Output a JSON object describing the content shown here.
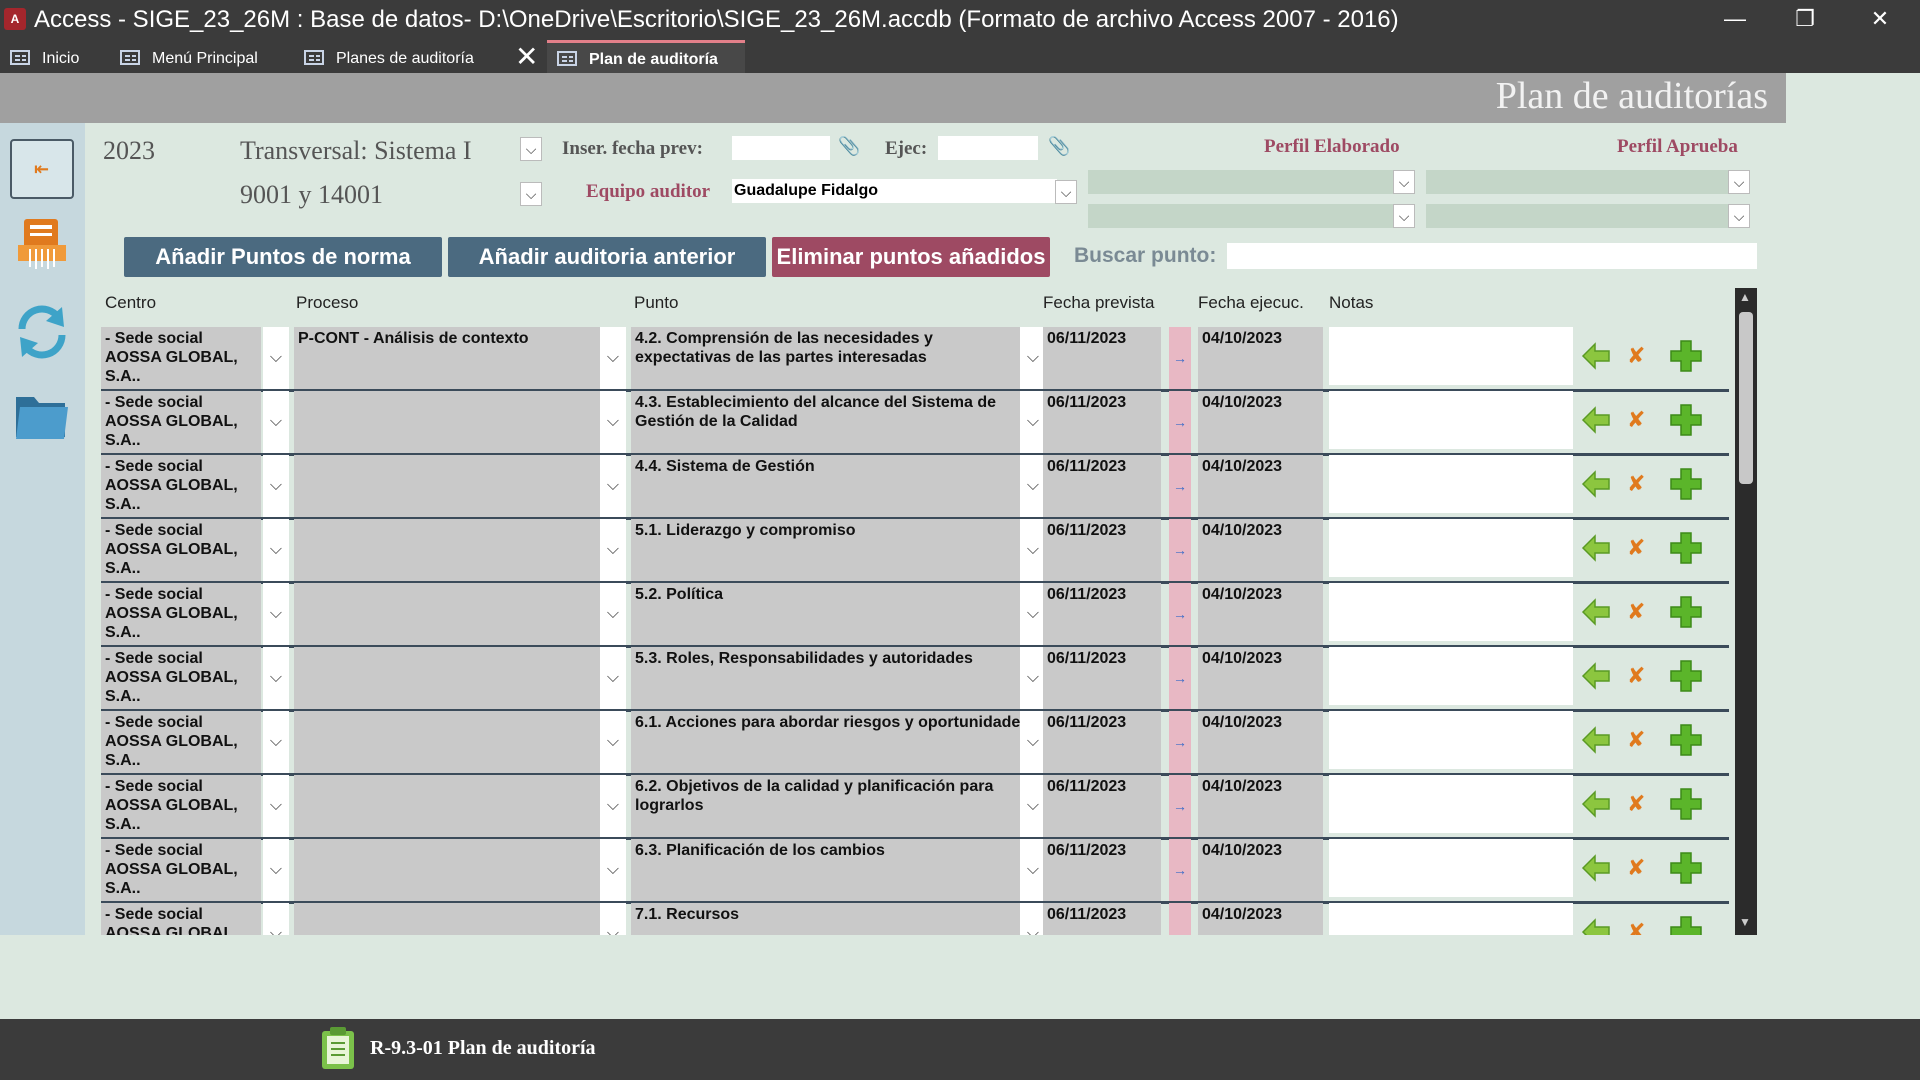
{
  "window": {
    "title": "Access - SIGE_23_26M : Base de datos- D:\\OneDrive\\Escritorio\\SIGE_23_26M.accdb (Formato de archivo Access 2007 - 2016)",
    "app_icon": "A",
    "minimize": "—",
    "restore": "❐",
    "close": "✕"
  },
  "tabs": [
    {
      "label": "Inicio"
    },
    {
      "label": "Menú Principal"
    },
    {
      "label": "Planes de auditoría"
    },
    {
      "label": "Plan de auditoría"
    }
  ],
  "tab_close_glyph": "✕",
  "form": {
    "title": "Plan de auditorías",
    "year": "2023",
    "transversal": "Transversal: Sistema I",
    "norma": "9001 y 14001",
    "inser_fecha_label": "Inser. fecha prev:",
    "ejec_label": "Ejec:",
    "equipo_label": "Equipo auditor",
    "equipo_value": "Guadalupe Fidalgo",
    "perfil_elaborado": "Perfil Elaborado",
    "perfil_aprueba": "Perfil Aprueba",
    "buscar_label": "Buscar punto:",
    "buscar_value": ""
  },
  "buttons": {
    "add_points": "Añadir Puntos de norma",
    "add_previous": "Añadir auditoria anterior",
    "delete_added": "Eliminar puntos añadidos"
  },
  "columns": {
    "centro": "Centro",
    "proceso": "Proceso",
    "punto": "Punto",
    "fecha_prevista": "Fecha prevista",
    "fecha_ejecuc": "Fecha ejecuc.",
    "notas": "Notas"
  },
  "glyphs": {
    "dropdown": "⌵",
    "arrow_right": "→",
    "delete": "✘",
    "paperclip": "📎"
  },
  "rows": [
    {
      "centro": "- Sede social AOSSA GLOBAL, S.A..",
      "proceso": "P-CONT - Análisis de contexto",
      "punto": "4.2. Comprensión de las necesidades y expectativas de las partes interesadas",
      "fecha_prevista": "06/11/2023",
      "fecha_ejecuc": "04/10/2023",
      "notas": ""
    },
    {
      "centro": "- Sede social AOSSA GLOBAL, S.A..",
      "proceso": "",
      "punto": "4.3. Establecimiento del alcance del Sistema de Gestión de la Calidad",
      "fecha_prevista": "06/11/2023",
      "fecha_ejecuc": "04/10/2023",
      "notas": ""
    },
    {
      "centro": "- Sede social AOSSA GLOBAL, S.A..",
      "proceso": "",
      "punto": "4.4. Sistema de Gestión",
      "fecha_prevista": "06/11/2023",
      "fecha_ejecuc": "04/10/2023",
      "notas": ""
    },
    {
      "centro": "- Sede social AOSSA GLOBAL, S.A..",
      "proceso": "",
      "punto": "5.1. Liderazgo y compromiso",
      "fecha_prevista": "06/11/2023",
      "fecha_ejecuc": "04/10/2023",
      "notas": ""
    },
    {
      "centro": "- Sede social AOSSA GLOBAL, S.A..",
      "proceso": "",
      "punto": "5.2. Política",
      "fecha_prevista": "06/11/2023",
      "fecha_ejecuc": "04/10/2023",
      "notas": ""
    },
    {
      "centro": "- Sede social AOSSA GLOBAL, S.A..",
      "proceso": "",
      "punto": "5.3. Roles, Responsabilidades y autoridades",
      "fecha_prevista": "06/11/2023",
      "fecha_ejecuc": "04/10/2023",
      "notas": ""
    },
    {
      "centro": "- Sede social AOSSA GLOBAL, S.A..",
      "proceso": "",
      "punto": "6.1. Acciones para abordar riesgos y oportunidades",
      "fecha_prevista": "06/11/2023",
      "fecha_ejecuc": "04/10/2023",
      "notas": ""
    },
    {
      "centro": "- Sede social AOSSA GLOBAL, S.A..",
      "proceso": "",
      "punto": "6.2. Objetivos de la calidad y planificación para lograrlos",
      "fecha_prevista": "06/11/2023",
      "fecha_ejecuc": "04/10/2023",
      "notas": ""
    },
    {
      "centro": "- Sede social AOSSA GLOBAL, S.A..",
      "proceso": "",
      "punto": "6.3. Planificación de los cambios",
      "fecha_prevista": "06/11/2023",
      "fecha_ejecuc": "04/10/2023",
      "notas": ""
    },
    {
      "centro": "- Sede social AOSSA GLOBAL, S.A..",
      "proceso": "",
      "punto": "7.1. Recursos",
      "fecha_prevista": "06/11/2023",
      "fecha_ejecuc": "04/10/2023",
      "notas": ""
    }
  ],
  "bottom": {
    "title": "R-9.3-01 Plan de auditoría"
  },
  "colors": {
    "accent_tab": "#e3808a",
    "button_blue": "#4b6a80",
    "button_red": "#9e4a63",
    "add_green": "#5bb52a",
    "delete_orange": "#e07a1e"
  },
  "icons": {
    "nav": [
      "exit-icon",
      "pdf-report-icon",
      "refresh-icon",
      "folder-icon"
    ],
    "row": [
      "back-arrow-icon",
      "delete-icon",
      "add-icon"
    ]
  }
}
